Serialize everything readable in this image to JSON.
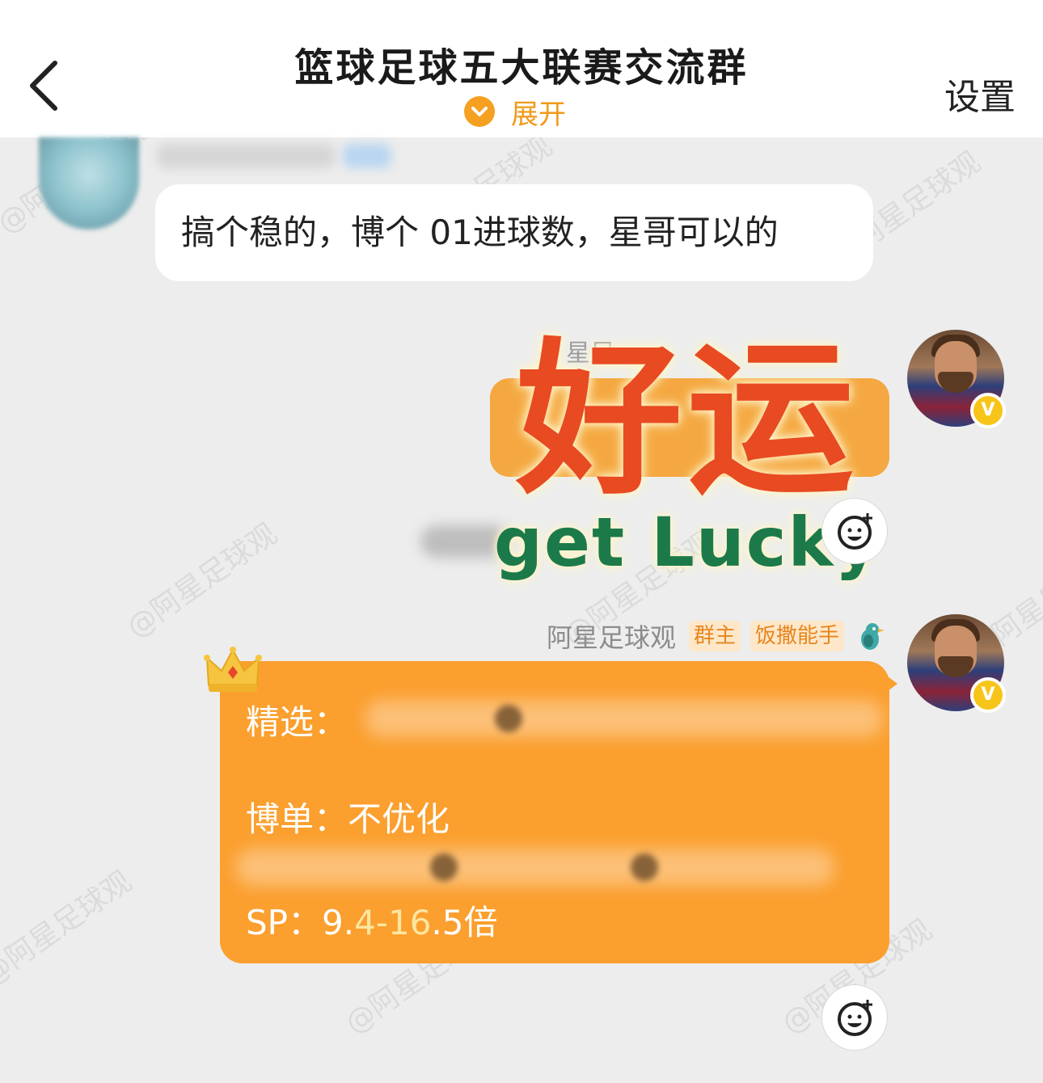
{
  "header": {
    "title": "篮球足球五大联赛交流群",
    "expand_label": "展开",
    "settings_label": "设置"
  },
  "watermark": "@阿星足球观",
  "messages": {
    "incoming": {
      "text": "搞个稳的，博个 01进球数，星哥可以的"
    },
    "sticker": {
      "sender_ghost": "星足",
      "text_cn": "好运",
      "text_en": "get Lucky"
    },
    "main": {
      "sender": "阿星足球观",
      "tags": [
        "群主",
        "饭撒能手"
      ],
      "line1_label": "精选：",
      "line2": "博单：不优化",
      "sp_label": "SP：",
      "sp_parts": [
        "9.",
        "4",
        "-",
        "16",
        ".5",
        "倍"
      ]
    }
  },
  "colors": {
    "accent_orange": "#fb9f2e",
    "header_bg": "#ffffff",
    "chat_bg": "#ededed",
    "verified_badge": "#f7c51a"
  }
}
